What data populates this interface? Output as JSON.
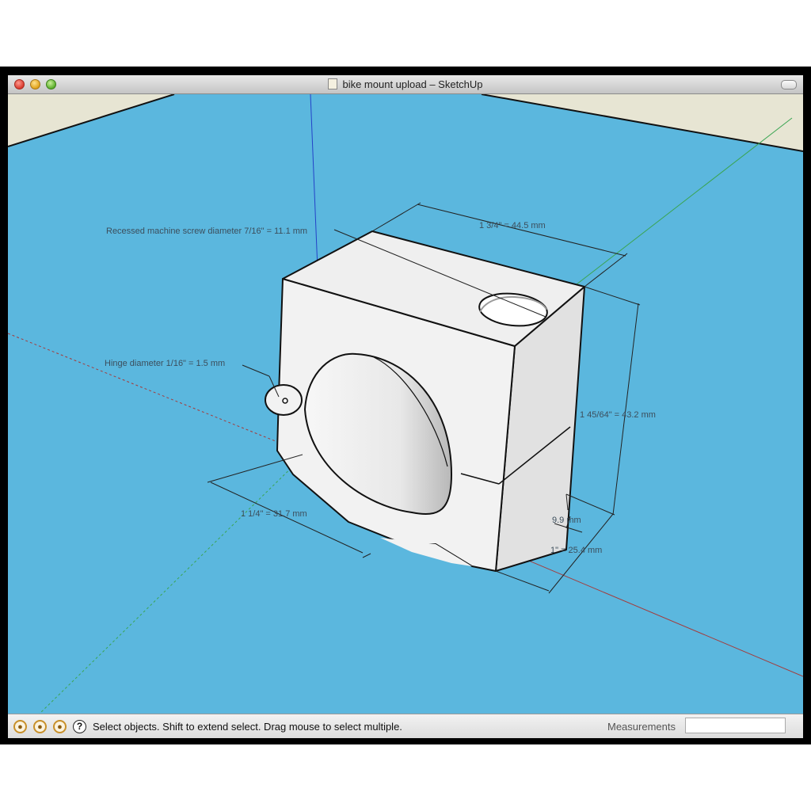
{
  "window": {
    "title": "bike mount upload – SketchUp",
    "document_icon": "document-icon",
    "title_controls": [
      "close-icon",
      "minimize-icon",
      "zoom-icon"
    ],
    "toolbar_toggle_icon": "pill-icon"
  },
  "viewport": {
    "colors": {
      "ground": "#5bb7de",
      "sky": "#e7e5d3",
      "model_face_light": "#f2f2f2",
      "model_face_mid": "#e1e1e1",
      "model_face_dark": "#cfcfcf",
      "axis_red": "#a53a3a",
      "axis_green": "#3aa552",
      "axis_blue": "#2342c8",
      "dimension": "#3c4e5c"
    },
    "dimensions": {
      "top_width": "1 3/4\" = 44.5 mm",
      "screw_hole": "Recessed machine screw diameter 7/16\" = 11.1 mm",
      "hinge": "Hinge diameter 1/16\" = 1.5 mm",
      "height": "1 45/64\" = 43.2 mm",
      "bore": "1 1/4\" = 31.7 mm",
      "gap": "9.9 mm",
      "depth": "1\" = 25.4 mm"
    }
  },
  "statusbar": {
    "geo_icons": [
      "geolocation-icon",
      "credits-icon",
      "google-icon"
    ],
    "help_icon": "help-icon",
    "help_glyph": "?",
    "status_text": "Select objects. Shift to extend select. Drag mouse to select multiple.",
    "measurements_label": "Measurements",
    "measurements_value": ""
  }
}
